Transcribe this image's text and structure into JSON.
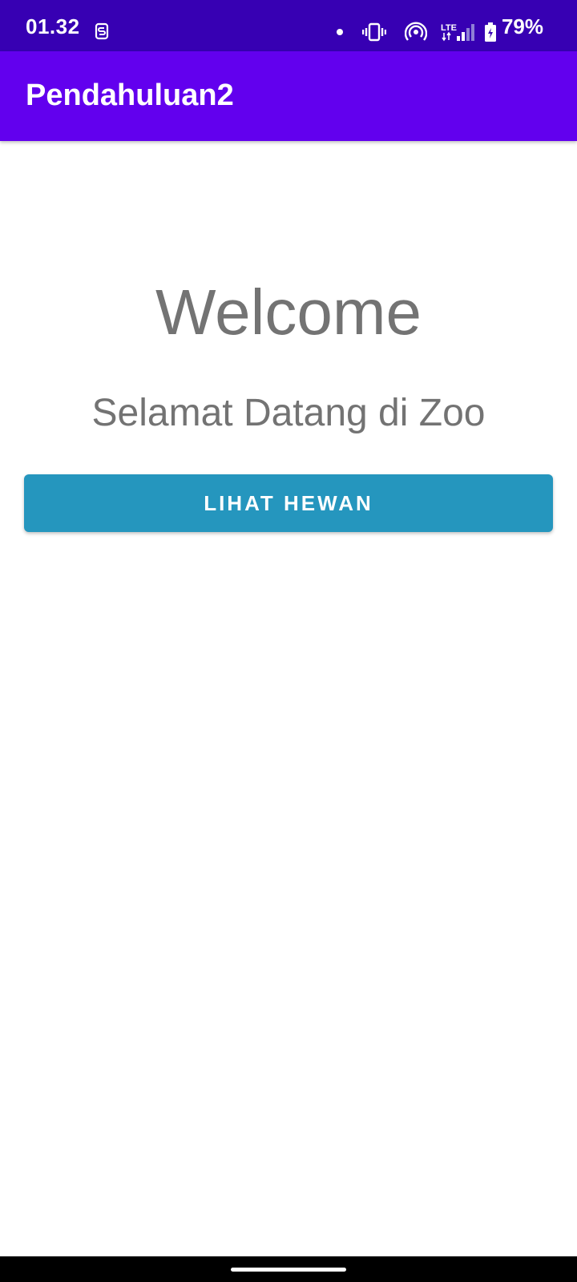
{
  "status_bar": {
    "time": "01.32",
    "battery_percent": "79%",
    "network_type": "LTE",
    "icons": [
      "sim-toolkit-icon",
      "notification-dot-icon",
      "vibrate-icon",
      "hotspot-icon",
      "lte-signal-icon",
      "battery-charging-icon"
    ]
  },
  "app_bar": {
    "title": "Pendahuluan2"
  },
  "main": {
    "heading": "Welcome",
    "subtitle": "Selamat Datang di Zoo",
    "button_label": "LIHAT HEWAN"
  },
  "colors": {
    "status_bar": "#3700b3",
    "app_bar": "#6200ee",
    "button": "#2596be",
    "text_gray": "#737373"
  }
}
